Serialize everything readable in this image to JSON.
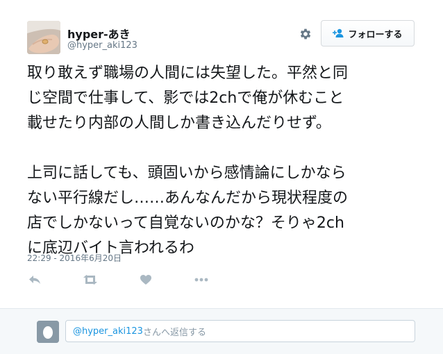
{
  "user": {
    "display_name": "hyper-あき",
    "handle": "@hyper_aki123"
  },
  "header": {
    "settings_icon": "gear-icon",
    "follow_icon": "person-add-icon",
    "follow_label": "フォローする"
  },
  "tweet": {
    "paragraph_1": "取り敢えず職場の人間には失望した。平然と同\nじ空間で仕事して、影では2chで俺が休むこと\n載せたり内部の人間しか書き込んだりせず。",
    "paragraph_2": "上司に話しても、頭固いから感情論にしかなら\nない平行線だし……あんなんだから現状程度の\n店でしかないって自覚ないのかな？そりゃ2ch\nに底辺バイト言われるわ",
    "timestamp": "22:29 - 2016年6月20日"
  },
  "actions": {
    "icons": [
      "reply-icon",
      "retweet-icon",
      "like-icon",
      "more-icon"
    ]
  },
  "reply": {
    "mention": "@hyper_aki123",
    "placeholder_suffix": "さんへ返信する"
  },
  "colors": {
    "text": "#14171a",
    "secondary": "#657786",
    "action_icon": "#aab8c2",
    "link": "#1b95e0",
    "reply_bar_bg": "#f5f8fa"
  }
}
